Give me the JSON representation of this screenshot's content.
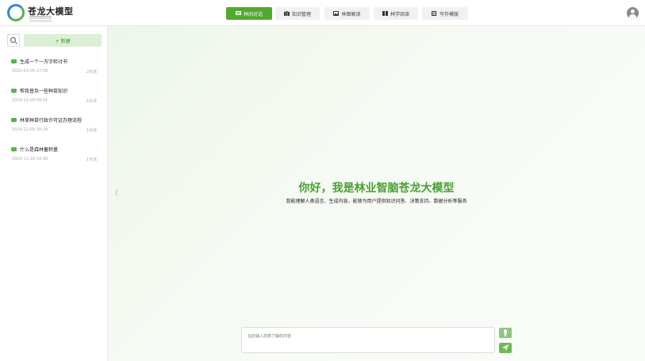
{
  "header": {
    "logo_title": "苍龙大模型",
    "logo_subtitle": "ASSISTDRAGON"
  },
  "nav": {
    "items": [
      {
        "label": "林间对话",
        "active": true,
        "icon": "chat-icon"
      },
      {
        "label": "知识管理",
        "active": false,
        "icon": "book-icon"
      },
      {
        "label": "林图解读",
        "active": false,
        "icon": "image-icon"
      },
      {
        "label": "林学阅读",
        "active": false,
        "icon": "open-book-icon"
      },
      {
        "label": "写作模版",
        "active": false,
        "icon": "document-icon"
      }
    ]
  },
  "sidebar": {
    "new_label": "+ 新建",
    "history": [
      {
        "title": "生成一个一万字检讨书",
        "date": "2025-03-05 17:58",
        "count": "2对话"
      },
      {
        "title": "帮我普及一些种苗知识",
        "date": "2024-12-09 09:31",
        "count": "1对话"
      },
      {
        "title": "林草种苗行政许可证办理流程",
        "date": "2024-12-09 09:28",
        "count": "1对话"
      },
      {
        "title": "什么是森林蓄积量",
        "date": "2024-11-18 14:39",
        "count": "1对话"
      }
    ]
  },
  "main": {
    "collapse_glyph": "《",
    "greeting": "你好，我是林业智脑苍龙大模型",
    "subtitle": "我能理解人类语言、生成内容，能够为用户提供知识问答、决策支持、数据分析等服务",
    "input_placeholder": "在此输入您想了解的内容"
  },
  "colors": {
    "accent": "#52a92f",
    "greeting": "#4aa032",
    "new_button_bg": "#dcefd6"
  }
}
